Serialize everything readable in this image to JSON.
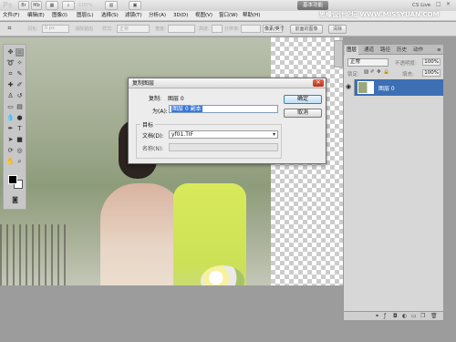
{
  "appbar": {
    "logo": "Ps",
    "zoom": "100%",
    "workspace": "基本功能",
    "cs_live": "CS Live",
    "icons": [
      "bridge-icon",
      "minibridge-icon",
      "zoom-icon",
      "screen-mode-icon"
    ]
  },
  "menubar": {
    "items": [
      "文件(F)",
      "编辑(E)",
      "图像(I)",
      "图层(L)",
      "选择(S)",
      "滤镜(T)",
      "分析(A)",
      "3D(D)",
      "视图(V)",
      "窗口(W)",
      "帮助(H)"
    ]
  },
  "watermark": "思缘设计论坛  WWW.MISSYUAN.COM",
  "optbar": {
    "feather_label": "羽化:",
    "feather_value": "0 px",
    "antialias_label": "消除锯齿",
    "style_label": "样式:",
    "style_value": "正常",
    "width_label": "宽度:",
    "height_label": "高度:",
    "resolution_label": "分辨率:",
    "unit_value": "像素/英寸",
    "front_image_button": "前面的图像",
    "clear_button": "清除"
  },
  "dialog": {
    "title": "复制图层",
    "copy_label": "复制:",
    "copy_value": "图层 0",
    "as_label": "为(A):",
    "as_value": "图层 0 副本",
    "ok_button": "确定",
    "cancel_button": "取消",
    "group_title": "目标",
    "document_label": "文档(D):",
    "document_value": "yf01.TIF",
    "name_label": "名称(N):",
    "name_value": ""
  },
  "layers_panel": {
    "tabs": [
      "图层",
      "通道",
      "路径",
      "历史",
      "动作"
    ],
    "blend_mode": "正常",
    "opacity_label": "不透明度:",
    "opacity_value": "100%",
    "lock_label": "锁定:",
    "fill_label": "填充:",
    "fill_value": "100%",
    "layer_name": "图层 0"
  },
  "colors": {
    "selected_layer": "#3d6fb4",
    "text_selection": "#3875d7"
  }
}
